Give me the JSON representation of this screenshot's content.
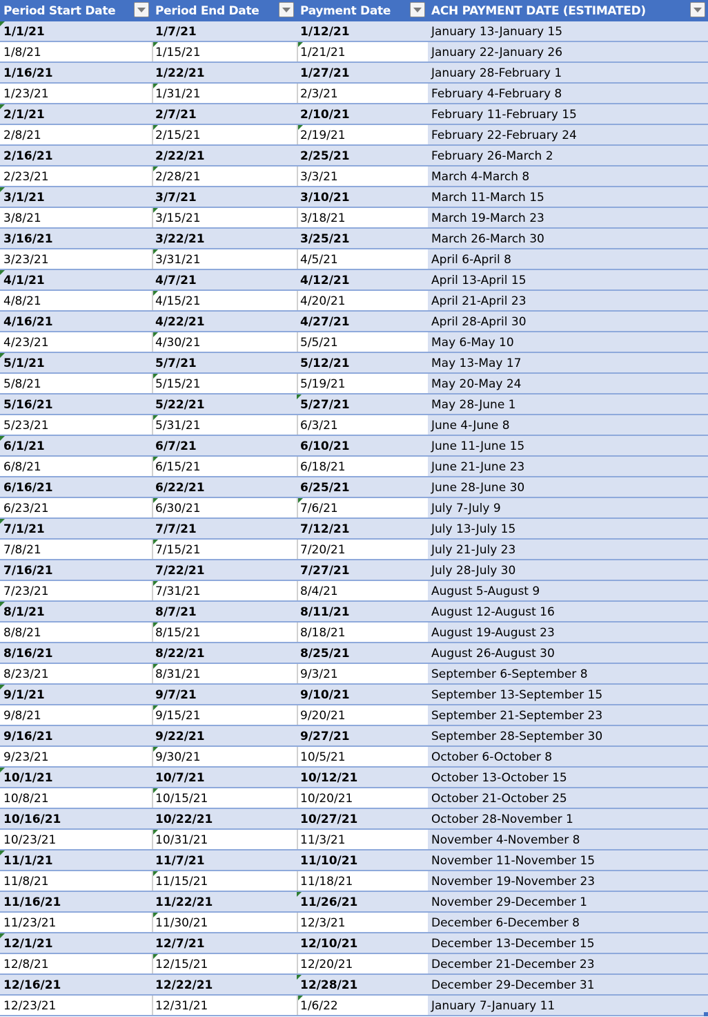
{
  "table": {
    "columns": [
      {
        "label": "Period Start Date",
        "filter_icon": "filter-dropdown-icon"
      },
      {
        "label": "Period End Date",
        "filter_icon": "filter-dropdown-icon"
      },
      {
        "label": "Payment Date",
        "filter_icon": "filter-dropdown-icon"
      },
      {
        "label": "ACH PAYMENT DATE (ESTIMATED)",
        "filter_icon": "filter-dropdown-icon"
      }
    ],
    "colors": {
      "header_bg": "#4472c4",
      "band_bg": "#d9e1f2",
      "row_border": "#8ea9db",
      "error_marker": "#2e7d32"
    },
    "rows": [
      {
        "start": "1/1/21",
        "end": "1/7/21",
        "payment": "1/12/21",
        "ach": "January 13-January 15",
        "flags": [
          true,
          false,
          false
        ]
      },
      {
        "start": "1/8/21",
        "end": "1/15/21",
        "payment": "1/21/21",
        "ach": "January 22-January 26",
        "flags": [
          false,
          true,
          true
        ]
      },
      {
        "start": "1/16/21",
        "end": "1/22/21",
        "payment": "1/27/21",
        "ach": "January 28-February 1",
        "flags": [
          false,
          false,
          false
        ]
      },
      {
        "start": "1/23/21",
        "end": "1/31/21",
        "payment": "2/3/21",
        "ach": "February 4-February 8",
        "flags": [
          false,
          true,
          false
        ]
      },
      {
        "start": "2/1/21",
        "end": "2/7/21",
        "payment": "2/10/21",
        "ach": "February 11-February 15",
        "flags": [
          true,
          false,
          false
        ]
      },
      {
        "start": "2/8/21",
        "end": "2/15/21",
        "payment": "2/19/21",
        "ach": "February 22-February 24",
        "flags": [
          false,
          true,
          true
        ]
      },
      {
        "start": "2/16/21",
        "end": "2/22/21",
        "payment": "2/25/21",
        "ach": "February 26-March 2",
        "flags": [
          false,
          false,
          false
        ]
      },
      {
        "start": "2/23/21",
        "end": "2/28/21",
        "payment": "3/3/21",
        "ach": "March 4-March 8",
        "flags": [
          false,
          true,
          false
        ]
      },
      {
        "start": "3/1/21",
        "end": "3/7/21",
        "payment": "3/10/21",
        "ach": "March 11-March 15",
        "flags": [
          true,
          false,
          false
        ]
      },
      {
        "start": "3/8/21",
        "end": "3/15/21",
        "payment": "3/18/21",
        "ach": "March 19-March 23",
        "flags": [
          false,
          true,
          false
        ]
      },
      {
        "start": "3/16/21",
        "end": "3/22/21",
        "payment": "3/25/21",
        "ach": "March 26-March 30",
        "flags": [
          false,
          false,
          false
        ]
      },
      {
        "start": "3/23/21",
        "end": "3/31/21",
        "payment": "4/5/21",
        "ach": "April 6-April 8",
        "flags": [
          false,
          true,
          false
        ]
      },
      {
        "start": "4/1/21",
        "end": "4/7/21",
        "payment": "4/12/21",
        "ach": "April 13-April 15",
        "flags": [
          true,
          false,
          false
        ]
      },
      {
        "start": "4/8/21",
        "end": "4/15/21",
        "payment": "4/20/21",
        "ach": "April 21-April 23",
        "flags": [
          false,
          true,
          false
        ]
      },
      {
        "start": "4/16/21",
        "end": "4/22/21",
        "payment": "4/27/21",
        "ach": "April 28-April 30",
        "flags": [
          false,
          false,
          false
        ]
      },
      {
        "start": "4/23/21",
        "end": "4/30/21",
        "payment": "5/5/21",
        "ach": "May 6-May 10",
        "flags": [
          false,
          true,
          false
        ]
      },
      {
        "start": "5/1/21",
        "end": "5/7/21",
        "payment": "5/12/21",
        "ach": "May 13-May 17",
        "flags": [
          true,
          false,
          false
        ]
      },
      {
        "start": "5/8/21",
        "end": "5/15/21",
        "payment": "5/19/21",
        "ach": "May 20-May 24",
        "flags": [
          false,
          true,
          false
        ]
      },
      {
        "start": "5/16/21",
        "end": "5/22/21",
        "payment": "5/27/21",
        "ach": "May 28-June 1",
        "flags": [
          false,
          false,
          true
        ]
      },
      {
        "start": "5/23/21",
        "end": "5/31/21",
        "payment": "6/3/21",
        "ach": "June 4-June 8",
        "flags": [
          false,
          true,
          false
        ]
      },
      {
        "start": "6/1/21",
        "end": "6/7/21",
        "payment": "6/10/21",
        "ach": "June 11-June 15",
        "flags": [
          true,
          false,
          false
        ]
      },
      {
        "start": "6/8/21",
        "end": "6/15/21",
        "payment": "6/18/21",
        "ach": "June 21-June 23",
        "flags": [
          false,
          true,
          false
        ]
      },
      {
        "start": "6/16/21",
        "end": "6/22/21",
        "payment": "6/25/21",
        "ach": "June 28-June 30",
        "flags": [
          false,
          false,
          false
        ]
      },
      {
        "start": "6/23/21",
        "end": "6/30/21",
        "payment": "7/6/21",
        "ach": "July 7-July 9",
        "flags": [
          false,
          true,
          true
        ]
      },
      {
        "start": "7/1/21",
        "end": "7/7/21",
        "payment": "7/12/21",
        "ach": "July 13-July 15",
        "flags": [
          true,
          false,
          false
        ]
      },
      {
        "start": "7/8/21",
        "end": "7/15/21",
        "payment": "7/20/21",
        "ach": "July 21-July 23",
        "flags": [
          false,
          true,
          false
        ]
      },
      {
        "start": "7/16/21",
        "end": "7/22/21",
        "payment": "7/27/21",
        "ach": "July 28-July 30",
        "flags": [
          false,
          false,
          false
        ]
      },
      {
        "start": "7/23/21",
        "end": "7/31/21",
        "payment": "8/4/21",
        "ach": "August 5-August 9",
        "flags": [
          false,
          true,
          false
        ]
      },
      {
        "start": "8/1/21",
        "end": "8/7/21",
        "payment": "8/11/21",
        "ach": "August 12-August 16",
        "flags": [
          true,
          false,
          false
        ]
      },
      {
        "start": "8/8/21",
        "end": "8/15/21",
        "payment": "8/18/21",
        "ach": "August 19-August 23",
        "flags": [
          false,
          true,
          false
        ]
      },
      {
        "start": "8/16/21",
        "end": "8/22/21",
        "payment": "8/25/21",
        "ach": "August 26-August 30",
        "flags": [
          false,
          false,
          false
        ]
      },
      {
        "start": "8/23/21",
        "end": "8/31/21",
        "payment": "9/3/21",
        "ach": "September 6-September 8",
        "flags": [
          false,
          true,
          false
        ]
      },
      {
        "start": "9/1/21",
        "end": "9/7/21",
        "payment": "9/10/21",
        "ach": "September 13-September 15",
        "flags": [
          true,
          false,
          false
        ]
      },
      {
        "start": "9/8/21",
        "end": "9/15/21",
        "payment": "9/20/21",
        "ach": "September 21-September 23",
        "flags": [
          false,
          true,
          false
        ]
      },
      {
        "start": "9/16/21",
        "end": "9/22/21",
        "payment": "9/27/21",
        "ach": "September 28-September 30",
        "flags": [
          false,
          false,
          false
        ]
      },
      {
        "start": "9/23/21",
        "end": "9/30/21",
        "payment": "10/5/21",
        "ach": "October 6-October 8",
        "flags": [
          false,
          true,
          false
        ]
      },
      {
        "start": "10/1/21",
        "end": "10/7/21",
        "payment": "10/12/21",
        "ach": "October 13-October 15",
        "flags": [
          true,
          false,
          false
        ]
      },
      {
        "start": "10/8/21",
        "end": "10/15/21",
        "payment": "10/20/21",
        "ach": "October 21-October 25",
        "flags": [
          false,
          true,
          false
        ]
      },
      {
        "start": "10/16/21",
        "end": "10/22/21",
        "payment": "10/27/21",
        "ach": "October 28-November 1",
        "flags": [
          false,
          false,
          false
        ]
      },
      {
        "start": "10/23/21",
        "end": "10/31/21",
        "payment": "11/3/21",
        "ach": "November 4-November 8",
        "flags": [
          false,
          true,
          false
        ]
      },
      {
        "start": "11/1/21",
        "end": "11/7/21",
        "payment": "11/10/21",
        "ach": "November 11-November 15",
        "flags": [
          true,
          false,
          false
        ]
      },
      {
        "start": "11/8/21",
        "end": "11/15/21",
        "payment": "11/18/21",
        "ach": "November 19-November 23",
        "flags": [
          false,
          true,
          false
        ]
      },
      {
        "start": "11/16/21",
        "end": "11/22/21",
        "payment": "11/26/21",
        "ach": "November 29-December 1",
        "flags": [
          false,
          false,
          true
        ]
      },
      {
        "start": "11/23/21",
        "end": "11/30/21",
        "payment": "12/3/21",
        "ach": "December 6-December 8",
        "flags": [
          false,
          true,
          false
        ]
      },
      {
        "start": "12/1/21",
        "end": "12/7/21",
        "payment": "12/10/21",
        "ach": "December 13-December 15",
        "flags": [
          true,
          false,
          false
        ]
      },
      {
        "start": "12/8/21",
        "end": "12/15/21",
        "payment": "12/20/21",
        "ach": "December 21-December 23",
        "flags": [
          false,
          true,
          false
        ]
      },
      {
        "start": "12/16/21",
        "end": "12/22/21",
        "payment": "12/28/21",
        "ach": "December 29-December 31",
        "flags": [
          false,
          false,
          true
        ]
      },
      {
        "start": "12/23/21",
        "end": "12/31/21",
        "payment": "1/6/22",
        "ach": "January 7-January 11",
        "flags": [
          false,
          false,
          true
        ]
      }
    ]
  }
}
